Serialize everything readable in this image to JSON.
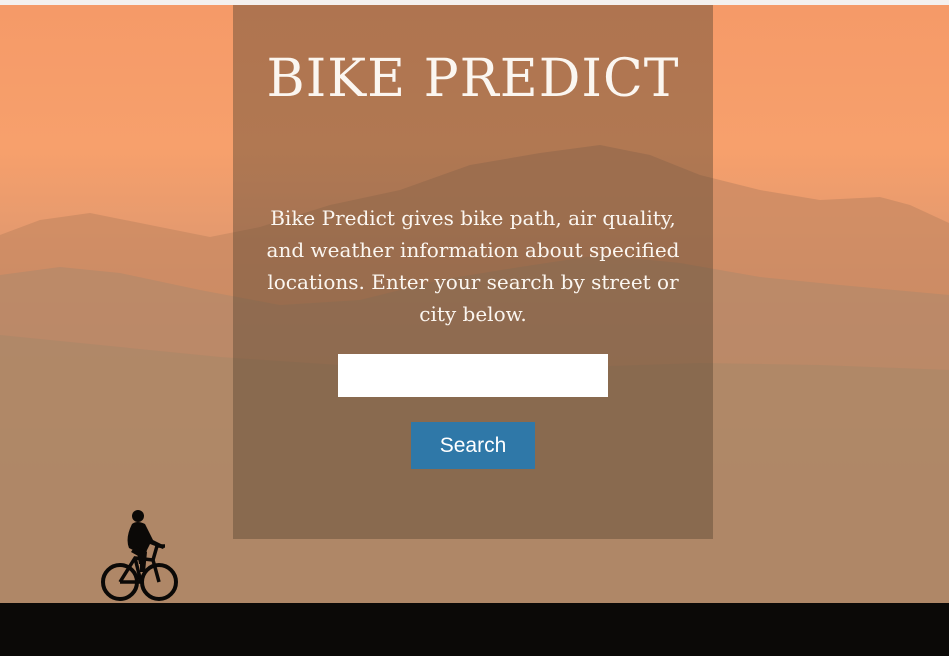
{
  "hero": {
    "title": "BIKE PREDICT",
    "description": "Bike Predict gives bike path, air quality, and weather information about specified locations. Enter your search by street or city below."
  },
  "search": {
    "value": "",
    "placeholder": "",
    "button_label": "Search"
  },
  "colors": {
    "sky": "#f59a68",
    "panel_overlay": "#5c4632",
    "button": "#2f78a8",
    "text": "#fbf6f0",
    "ground": "#0b0907"
  },
  "icons": {
    "background_figure": "cyclist-silhouette-icon"
  }
}
